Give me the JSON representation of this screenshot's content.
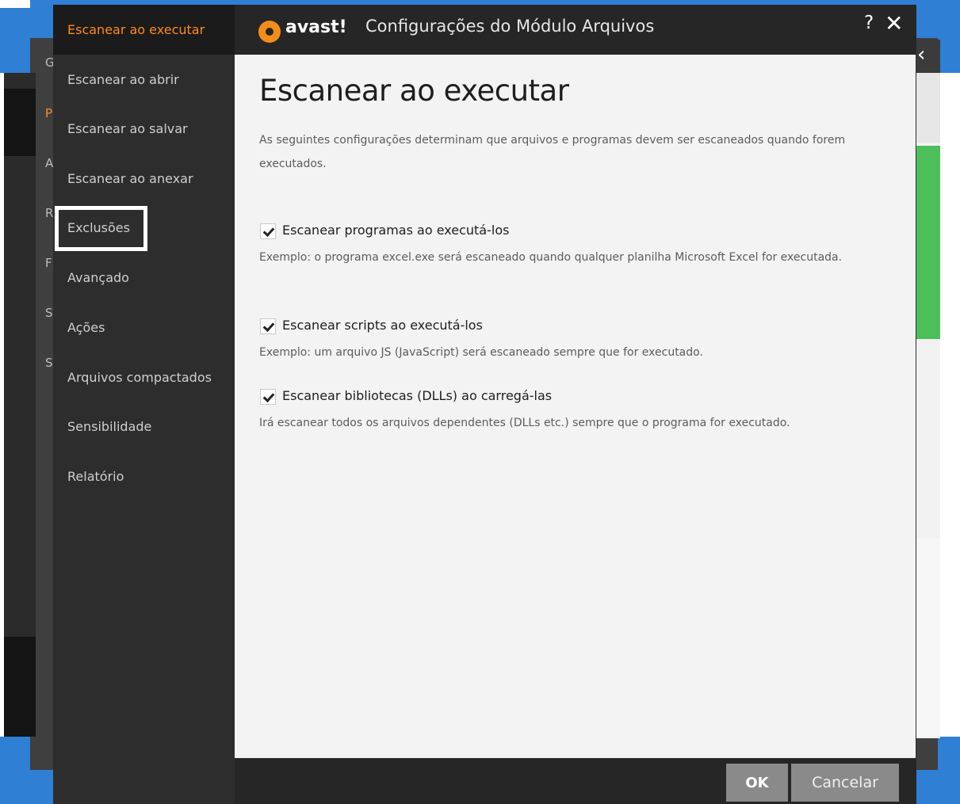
{
  "background": {
    "letters": [
      "G",
      "P",
      "A",
      "R",
      "F",
      "S",
      "S"
    ]
  },
  "dialog": {
    "title": "Configurações do Módulo Arquivos",
    "logo_text": "avast!",
    "help_label": "?",
    "close_label": "✕"
  },
  "sidebar": {
    "items": [
      {
        "label": "Escanear ao executar",
        "active": true
      },
      {
        "label": "Escanear ao abrir"
      },
      {
        "label": "Escanear ao salvar"
      },
      {
        "label": "Escanear ao anexar"
      },
      {
        "label": "Exclusões",
        "highlighted": true
      },
      {
        "label": "Avançado"
      },
      {
        "label": "Ações"
      },
      {
        "label": "Arquivos compactados"
      },
      {
        "label": "Sensibilidade"
      },
      {
        "label": "Relatório"
      }
    ]
  },
  "main": {
    "heading": "Escanear ao executar",
    "intro": "As seguintes configurações determinam que arquivos e programas devem ser escaneados quando forem executados.",
    "options": [
      {
        "label": "Escanear programas ao executá-los",
        "checked": true,
        "description": "Exemplo: o programa excel.exe será escaneado quando qualquer planilha Microsoft Excel for executada."
      },
      {
        "label": "Escanear scripts ao executá-los",
        "checked": true,
        "description": "Exemplo: um arquivo JS (JavaScript) será escaneado sempre que for executado."
      },
      {
        "label": "Escanear bibliotecas (DLLs) ao carregá-las",
        "checked": true,
        "description": "Irá escanear todos os arquivos dependentes (DLLs etc.) sempre que o programa for executado."
      }
    ]
  },
  "footer": {
    "ok_label": "OK",
    "cancel_label": "Cancelar"
  },
  "colors": {
    "accent": "#ff8a1f",
    "sidebar_bg": "#2d2d2d",
    "content_bg": "#f3f3f3",
    "button_bg": "#8a8a8a",
    "desktop_blue": "#2f7fd4",
    "bg_green": "#4cbf5a"
  },
  "icons": [
    "avast-logo-icon",
    "help-icon",
    "close-icon",
    "checkmark-icon"
  ]
}
